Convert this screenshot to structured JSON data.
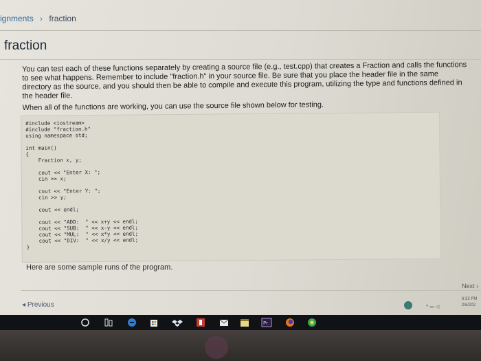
{
  "breadcrumb": {
    "items": [
      "ignments",
      "fraction"
    ],
    "separator": "›"
  },
  "page": {
    "title": "fraction",
    "intro_text": "You can test each of these functions separately by creating a source file (e.g., test.cpp) that creates a Fraction and calls the functions to see what happens. Remember to include \"fraction.h\" in your source file. Be sure that you place the header file in the same directory as the source, and you should then be able to compile and execute this program, utilizing the type and functions defined in the header file.",
    "intro_text_2": "When all of the functions are working, you can use the source file shown below for testing.",
    "code": "#include <iostream>\n#include \"fraction.h\"\nusing namespace std;\n\nint main()\n{\n    Fraction x, y;\n\n    cout << \"Enter X: \";\n    cin >> x;\n\n    cout << \"Enter Y: \";\n    cin >> y;\n\n    cout << endl;\n\n    cout << \"ADD:  \" << x+y << endl;\n    cout << \"SUB:  \" << x-y << endl;\n    cout << \"MUL:  \" << x*y << endl;\n    cout << \"DIV:  \" << x/y << endl;\n}",
    "outro_text": "Here are some sample runs of the program."
  },
  "pagination": {
    "next_label": "Next",
    "previous_label": "Previous"
  },
  "tray": {
    "time": "6:32 PM",
    "date": "2/6/202"
  },
  "taskbar": {
    "icons": [
      "start-icon",
      "task-view-icon",
      "edge-icon",
      "store-icon",
      "dropbox-icon",
      "app-icon",
      "mail-icon",
      "calendar-icon",
      "premiere-icon",
      "firefox-icon",
      "chrome-icon"
    ]
  },
  "colors": {
    "accent": "#2f6a9c",
    "screen_bg": "#e2e0d8",
    "taskbar_bg": "#101216"
  }
}
